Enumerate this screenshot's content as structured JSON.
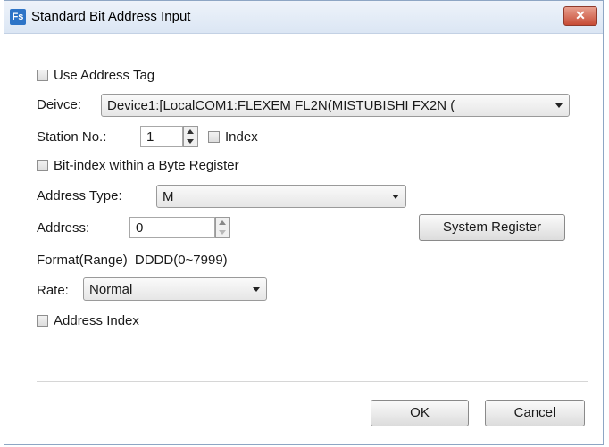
{
  "window": {
    "icon_label": "Fs",
    "title": "Standard Bit Address Input",
    "close_label": "✕"
  },
  "use_address_tag": {
    "label": "Use Address Tag",
    "checked": false
  },
  "device": {
    "label": "Deivce:",
    "value": "Device1:[LocalCOM1:FLEXEM FL2N(MISTUBISHI FX2N ("
  },
  "station": {
    "label": "Station No.:",
    "value": "1",
    "index_label": "Index",
    "index_checked": false
  },
  "bit_index": {
    "label": "Bit-index within a Byte Register",
    "checked": false
  },
  "address_type": {
    "label": "Address Type:",
    "value": "M"
  },
  "address": {
    "label": "Address:",
    "value": "0"
  },
  "system_register_button": "System Register",
  "format": {
    "label": "Format(Range)",
    "value": "DDDD(0~7999)"
  },
  "rate": {
    "label": "Rate:",
    "value": "Normal"
  },
  "address_index": {
    "label": "Address Index",
    "checked": false
  },
  "buttons": {
    "ok": "OK",
    "cancel": "Cancel"
  }
}
